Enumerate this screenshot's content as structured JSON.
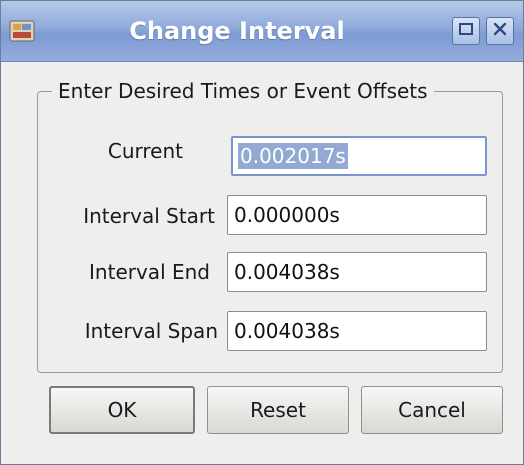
{
  "window": {
    "title": "Change Interval",
    "app_icon": "app-icon",
    "maximize_icon": "maximize-icon",
    "close_icon": "close-icon"
  },
  "group": {
    "legend": "Enter Desired Times or Event Offsets",
    "rows": [
      {
        "label": "Current",
        "value": "0.002017s",
        "selected": true
      },
      {
        "label": "Interval Start",
        "value": "0.000000s",
        "selected": false
      },
      {
        "label": "Interval End",
        "value": "0.004038s",
        "selected": false
      },
      {
        "label": "Interval Span",
        "value": "0.004038s",
        "selected": false
      }
    ]
  },
  "buttons": {
    "ok": "OK",
    "reset": "Reset",
    "cancel": "Cancel"
  },
  "colors": {
    "titlebar": "#8ea9da",
    "selection": "#93a9d4",
    "focus_border": "#7895cf",
    "window_bg": "#eeeeec"
  }
}
